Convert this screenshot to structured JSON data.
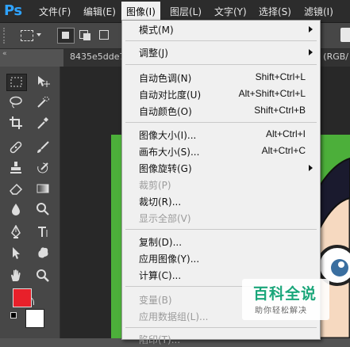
{
  "app": {
    "logo": "Ps"
  },
  "menubar": {
    "items": [
      "文件(F)",
      "编辑(E)",
      "图像(I)",
      "图层(L)",
      "文字(Y)",
      "选择(S)",
      "滤镜(I)"
    ],
    "active": "图像(I)"
  },
  "document_tab": {
    "title": "8435e5dde7",
    "right_text": "(RGB/"
  },
  "image_menu": {
    "items": [
      {
        "label": "模式(M)",
        "shortcut": "",
        "submenu": true,
        "enabled": true
      },
      {
        "label": "调整(J)",
        "shortcut": "",
        "submenu": true,
        "enabled": true
      },
      {
        "label": "自动色调(N)",
        "shortcut": "Shift+Ctrl+L",
        "submenu": false,
        "enabled": true
      },
      {
        "label": "自动对比度(U)",
        "shortcut": "Alt+Shift+Ctrl+L",
        "submenu": false,
        "enabled": true
      },
      {
        "label": "自动颜色(O)",
        "shortcut": "Shift+Ctrl+B",
        "submenu": false,
        "enabled": true
      },
      {
        "label": "图像大小(I)...",
        "shortcut": "Alt+Ctrl+I",
        "submenu": false,
        "enabled": true
      },
      {
        "label": "画布大小(S)...",
        "shortcut": "Alt+Ctrl+C",
        "submenu": false,
        "enabled": true
      },
      {
        "label": "图像旋转(G)",
        "shortcut": "",
        "submenu": true,
        "enabled": true
      },
      {
        "label": "裁剪(P)",
        "shortcut": "",
        "submenu": false,
        "enabled": false
      },
      {
        "label": "裁切(R)...",
        "shortcut": "",
        "submenu": false,
        "enabled": true
      },
      {
        "label": "显示全部(V)",
        "shortcut": "",
        "submenu": false,
        "enabled": false
      },
      {
        "label": "复制(D)...",
        "shortcut": "",
        "submenu": false,
        "enabled": true
      },
      {
        "label": "应用图像(Y)...",
        "shortcut": "",
        "submenu": false,
        "enabled": true
      },
      {
        "label": "计算(C)...",
        "shortcut": "",
        "submenu": false,
        "enabled": true
      },
      {
        "label": "变量(B)",
        "shortcut": "",
        "submenu": true,
        "enabled": false
      },
      {
        "label": "应用数据组(L)...",
        "shortcut": "",
        "submenu": false,
        "enabled": false
      },
      {
        "label": "陷印(T)...",
        "shortcut": "",
        "submenu": false,
        "enabled": false
      }
    ]
  },
  "colors": {
    "foreground": "#e8202a",
    "background": "#ffffff",
    "canvas_green": "#4caf3a",
    "brand": "#2fa3ff"
  },
  "watermark": {
    "title": "百科全说",
    "subtitle": "助你轻松解决"
  }
}
